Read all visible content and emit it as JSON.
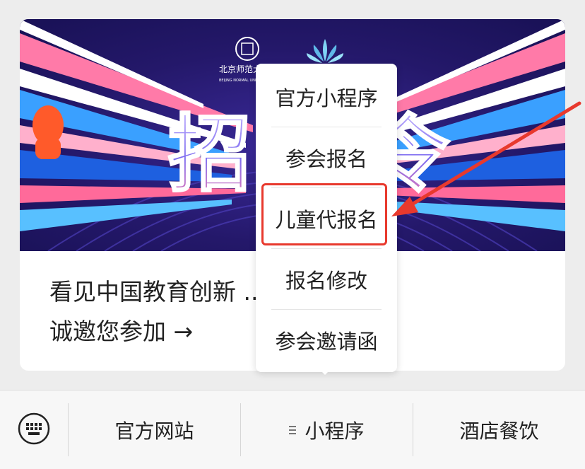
{
  "banner": {
    "headline_left": "招",
    "headline_right": "令",
    "logo_text": "北京师范大学",
    "logo_sub": "BEIJING NORMAL UNIVERSITY"
  },
  "article": {
    "text_line1": "看见中国教育创新 ...六届教博会，",
    "text_line2": "诚邀您参加 →"
  },
  "menu": {
    "items": [
      {
        "label": "官方小程序"
      },
      {
        "label": "参会报名"
      },
      {
        "label": "儿童代报名"
      },
      {
        "label": "报名修改"
      },
      {
        "label": "参会邀请函"
      }
    ],
    "highlighted_index": 2
  },
  "bottom_bar": {
    "keyboard_icon": "keyboard-icon",
    "tabs": [
      {
        "label": "官方网站"
      },
      {
        "label": "小程序"
      },
      {
        "label": "酒店餐饮"
      }
    ]
  },
  "colors": {
    "highlight": "#e8392d",
    "banner_bg": "#2a1b6e"
  }
}
